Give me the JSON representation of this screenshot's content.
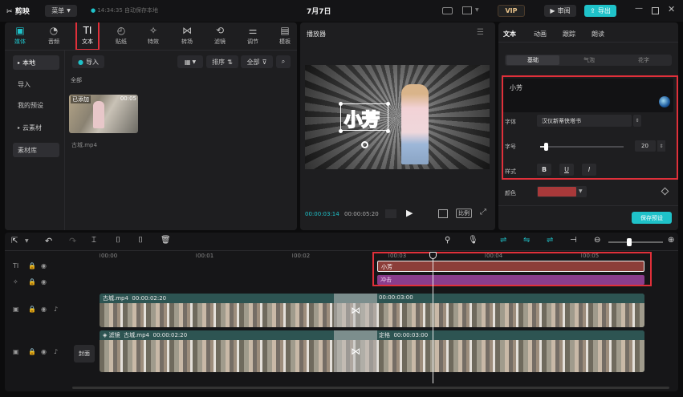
{
  "app": {
    "logo_text": "剪映",
    "menu_label": "菜单",
    "autosave": "14:34:35 自动保存本地",
    "project_title": "7月7日",
    "vip_label": "VIP",
    "review_label": "审阅",
    "export_label": "导出"
  },
  "toolbar": {
    "tabs": [
      {
        "label": "媒体",
        "icon": "▣"
      },
      {
        "label": "音频",
        "icon": "◔"
      },
      {
        "label": "文本",
        "icon": "TI"
      },
      {
        "label": "贴纸",
        "icon": "◴"
      },
      {
        "label": "特效",
        "icon": "✧"
      },
      {
        "label": "转场",
        "icon": "⋈"
      },
      {
        "label": "滤镜",
        "icon": "⟲"
      },
      {
        "label": "调节",
        "icon": "⚌"
      },
      {
        "label": "模板",
        "icon": "▤"
      }
    ]
  },
  "media": {
    "nav": [
      "本地",
      "导入",
      "我的预设",
      "云素材",
      "素材库"
    ],
    "import_label": "导入",
    "sort_label": "排序",
    "all_label": "全部",
    "section_label": "全部",
    "clip": {
      "badge": "已添加",
      "duration": "00:05",
      "name": "古城.mp4"
    }
  },
  "player": {
    "title": "播放器",
    "current_time": "00:00:03:14",
    "total_time": "00:00:05:20",
    "ratio_label": "比例",
    "overlay_text": "小芳"
  },
  "props": {
    "tabs": [
      "文本",
      "动画",
      "跟踪",
      "朗读"
    ],
    "subtabs": [
      "基础",
      "气泡",
      "花字"
    ],
    "text_value": "小芳",
    "font_label": "字体",
    "font_value": "汉仪新蒂侠塔书",
    "size_label": "字号",
    "size_value": "20",
    "size_fraction": 0.05,
    "style_label": "样式",
    "style_buttons": [
      "B",
      "U",
      "I"
    ],
    "color_label": "颜色",
    "color_value": "#a8393a",
    "save_preset": "保存预设"
  },
  "timeline": {
    "ruler": [
      "00:00",
      "00:01",
      "00:02",
      "00:03",
      "00:04",
      "00:05"
    ],
    "text_clip": "小芳",
    "effect_clip": "冲击",
    "main_clip": {
      "name": "古城.mp4",
      "duration": "00:00:02:20",
      "second_duration": "00:00:03:00"
    },
    "lower_clip": {
      "prefix": "滤镜",
      "name": "古城.mp4",
      "duration": "00:00:02:20",
      "second_label": "定格",
      "second_duration": "00:00:03:00"
    },
    "cover_label": "封面",
    "transition_icon": "⋈"
  },
  "colors": {
    "accent": "#1fc2c9",
    "highlight": "#e0303a",
    "text_clip": "#8c3e39",
    "effect_clip": "#8a3d8c",
    "video_header": "#2d5452"
  }
}
